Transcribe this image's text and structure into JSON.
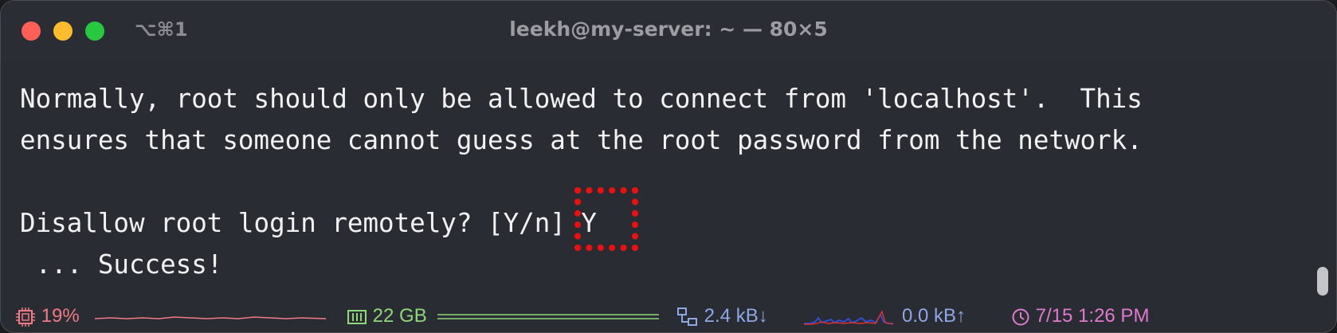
{
  "window": {
    "tab_shortcut": "⌥⌘1",
    "title": "leekh@my-server: ~ — 80×5"
  },
  "terminal": {
    "lines": [
      "Normally, root should only be allowed to connect from 'localhost'.  This",
      "ensures that someone cannot guess at the root password from the network.",
      "",
      "Disallow root login remotely? [Y/n] Y",
      " ... Success!"
    ]
  },
  "statusbar": {
    "cpu": {
      "icon": "cpu-icon",
      "value": "19%",
      "color": "#f07a85"
    },
    "memory": {
      "icon": "memory-icon",
      "value": "22 GB",
      "color": "#8fd67a"
    },
    "network_down": {
      "icon": "network-icon",
      "value": "2.4 kB↓",
      "color": "#8ea7e6"
    },
    "network_up": {
      "value": "0.0 kB↑",
      "color": "#8ea7e6"
    },
    "clock": {
      "icon": "clock-icon",
      "value": "7/15 1:26 PM",
      "color": "#e07ad0"
    }
  },
  "colors": {
    "background": "#2a2c33",
    "text": "#f2f2f2",
    "highlight": "#ee1010"
  }
}
